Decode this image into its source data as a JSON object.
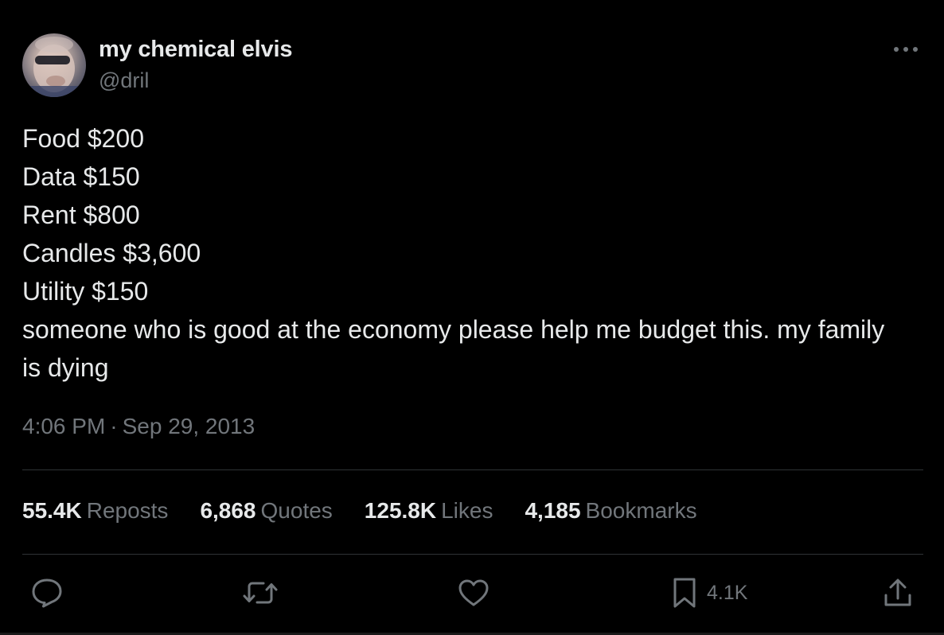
{
  "author": {
    "display_name": "my chemical elvis",
    "handle": "@dril",
    "avatar_icon": "profile-photo"
  },
  "tweet": {
    "lines": [
      "Food $200",
      "Data $150",
      "Rent $800",
      "Candles $3,600",
      "Utility $150",
      "someone who is good at the economy please help me budget this. my family is dying"
    ],
    "time": "4:06 PM",
    "separator": "·",
    "date": "Sep 29, 2013"
  },
  "stats": [
    {
      "value": "55.4K",
      "label": "Reposts"
    },
    {
      "value": "6,868",
      "label": "Quotes"
    },
    {
      "value": "125.8K",
      "label": "Likes"
    },
    {
      "value": "4,185",
      "label": "Bookmarks"
    }
  ],
  "actions": {
    "reply_icon": "speech-bubble-icon",
    "repost_icon": "repost-arrows-icon",
    "like_icon": "heart-icon",
    "bookmark_icon": "bookmark-icon",
    "bookmark_count": "4.1K",
    "share_icon": "share-upload-icon"
  },
  "colors": {
    "background": "#000000",
    "primary_text": "#e7e9ea",
    "secondary_text": "#71767b",
    "divider": "#2f3336"
  }
}
